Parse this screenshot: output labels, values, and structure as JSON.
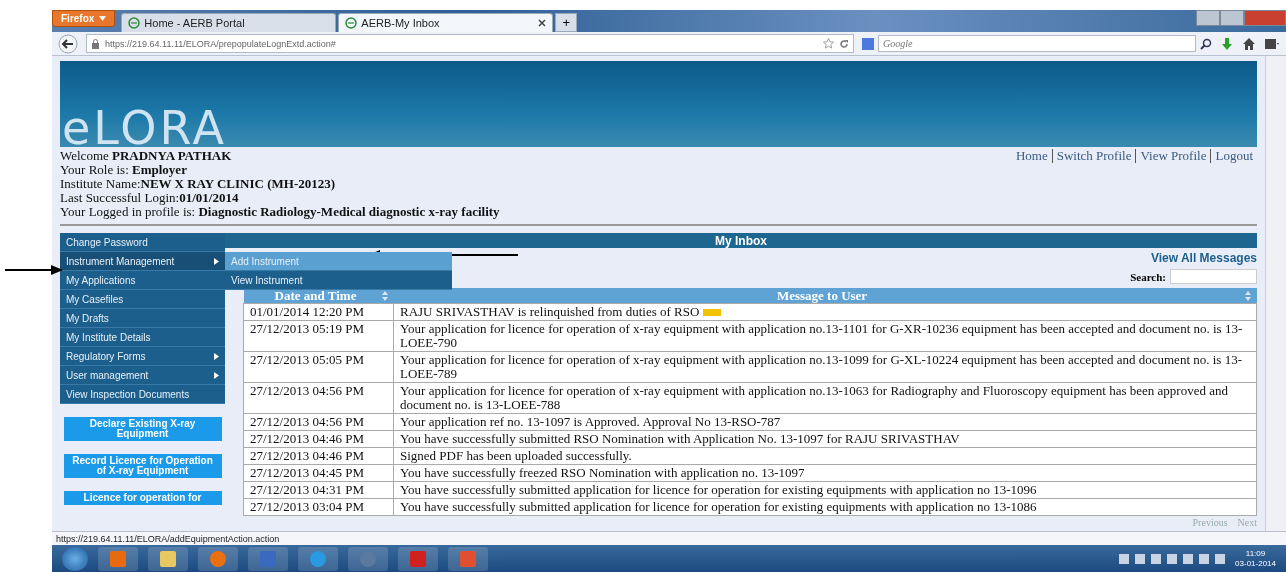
{
  "browser": {
    "menu_button": "Firefox",
    "tabs": [
      {
        "title": "Home - AERB Portal",
        "selected": false
      },
      {
        "title": "AERB-My Inbox",
        "selected": true
      }
    ],
    "new_tab": "+",
    "url": "https://219.64.11.11/ELORA/prepopulateLognExtd.action#",
    "search": {
      "placeholder": "Google"
    }
  },
  "header": {
    "logo": "eLORA"
  },
  "user_info": [
    {
      "label": "Welcome ",
      "value": "PRADNYA PATHAK"
    },
    {
      "label": "Your Role is: ",
      "value": "Employer"
    },
    {
      "label": "Institute Name:",
      "value": "NEW X RAY CLINIC (MH-20123)"
    },
    {
      "label": "Last Successful Login:",
      "value": "01/01/2014"
    },
    {
      "label": "Your Logged in profile is: ",
      "value": "Diagnostic Radiology-Medical diagnostic x-ray facility"
    }
  ],
  "top_links": [
    "Home",
    "Switch Profile",
    "View Profile",
    "Logout"
  ],
  "sidebar": {
    "menu": [
      {
        "label": "Change Password",
        "has_submenu": false,
        "expanded": false
      },
      {
        "label": "Instrument Management",
        "has_submenu": true,
        "expanded": true,
        "children": [
          {
            "label": "Add Instrument",
            "selected": true
          },
          {
            "label": "View Instrument",
            "selected": false
          }
        ]
      },
      {
        "label": "My Applications",
        "has_submenu": false,
        "expanded": false
      },
      {
        "label": "My Casefiles",
        "has_submenu": false,
        "expanded": false
      },
      {
        "label": "My Drafts",
        "has_submenu": false,
        "expanded": false
      },
      {
        "label": "My Institute Details",
        "has_submenu": false,
        "expanded": false
      },
      {
        "label": "Regulatory Forms",
        "has_submenu": true,
        "expanded": false
      },
      {
        "label": "User management",
        "has_submenu": true,
        "expanded": false
      },
      {
        "label": "View Inspection Documents",
        "has_submenu": false,
        "expanded": false
      }
    ],
    "action_buttons": [
      "Declare Existing X-ray Equipment",
      "Record Licence for Operation of X-ray Equipment",
      "Licence for operation for"
    ]
  },
  "inbox": {
    "title": "My Inbox",
    "view_all": "View All Messages",
    "search_label": "Search:",
    "columns": [
      "Date and Time",
      "Message to User"
    ],
    "rows": [
      {
        "date": "01/01/2014 12:20 PM",
        "message": "RAJU SRIVASTHAV is relinquished from duties of RSO",
        "new_badge": true
      },
      {
        "date": "27/12/2013 05:19 PM",
        "message": "Your application for licence for operation of x-ray equipment with application no.13-1101 for G-XR-10236 equipment has been accepted and document no. is 13-LOEE-790",
        "new_badge": false
      },
      {
        "date": "27/12/2013 05:05 PM",
        "message": "Your application for licence for operation of x-ray equipment with application no.13-1099 for G-XL-10224 equipment has been accepted and document no. is 13-LOEE-789",
        "new_badge": false
      },
      {
        "date": "27/12/2013 04:56 PM",
        "message": "Your application for licence for operation of x-ray equipment with application no.13-1063 for Radiography and Fluoroscopy equipment has been approved and document no. is 13-LOEE-788",
        "new_badge": false
      },
      {
        "date": "27/12/2013 04:56 PM",
        "message": "Your application ref no. 13-1097 is Approved. Approval No 13-RSO-787",
        "new_badge": false
      },
      {
        "date": "27/12/2013 04:46 PM",
        "message": "You have successfully submitted RSO Nomination with Application No. 13-1097 for RAJU SRIVASTHAV",
        "new_badge": false
      },
      {
        "date": "27/12/2013 04:46 PM",
        "message": "Signed PDF has been uploaded successfully.",
        "new_badge": false
      },
      {
        "date": "27/12/2013 04:45 PM",
        "message": "You have successfully freezed RSO Nomination with application no. 13-1097",
        "new_badge": false
      },
      {
        "date": "27/12/2013 04:31 PM",
        "message": "You have successfully submitted application for licence for operation for existing equipments with application no 13-1096",
        "new_badge": false
      },
      {
        "date": "27/12/2013 03:04 PM",
        "message": "You have successfully submitted application for licence for operation for existing equipments with application no 13-1086",
        "new_badge": false
      }
    ],
    "pagination": [
      "Previous",
      "Next"
    ]
  },
  "status_bar": {
    "url": "https://219.64.11.11/ELORA/addEquipmentAction.action"
  },
  "taskbar": {
    "time": "11:09",
    "date": "03-01-2014"
  }
}
